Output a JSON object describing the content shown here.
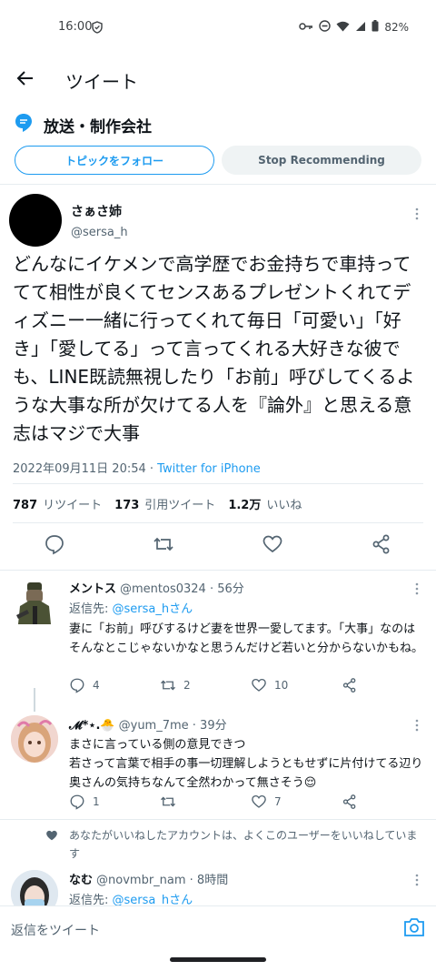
{
  "status": {
    "time": "16:00",
    "battery": "82%"
  },
  "header": {
    "title": "ツイート"
  },
  "topic": {
    "label": "放送・制作会社",
    "follow_btn": "トピックをフォロー",
    "stop_btn": "Stop Recommending"
  },
  "tweet": {
    "display_name": "さぁさ姉",
    "handle": "@sersa_h",
    "text": "どんなにイケメンで高学歴でお金持ちで車持っててて相性が良くてセンスあるプレゼントくれてディズニー一緒に行ってくれて毎日「可愛い」「好き」「愛してる」って言ってくれる大好きな彼でも、LINE既読無視したり「お前」呼びしてくるような大事な所が欠けてる人を『論外』と思える意志はマジで大事",
    "datetime": "2022年09月11日 20:54",
    "separator": " · ",
    "source": "Twitter for iPhone",
    "retweets_count": "787",
    "retweets_label": "リツイート",
    "quotes_count": "173",
    "quotes_label": "引用ツイート",
    "likes_count": "1.2万",
    "likes_label": "いいね"
  },
  "replies": [
    {
      "name": "メントス",
      "handle_time": "@mentos0324 · 56分",
      "reply_prefix": "返信先: ",
      "reply_to": "@sersa_hさん",
      "text": "妻に「お前」呼びするけど妻を世界一愛してます。「大事」なのはそんなとこじゃないかなと思うんだけど若いと分からないかもね。",
      "replies": "4",
      "retweets": "2",
      "likes": "10"
    },
    {
      "name": "𝓜*⋆.🐣",
      "handle_time": "@yum_7me · 39分",
      "text": "まさに言っている側の意見できつ\n若さって言葉で相手の事一切理解しようともせずに片付けてる辺り奥さんの気持ちなんて全然わかって無さそう😌",
      "replies": "1",
      "retweets": "",
      "likes": "7"
    },
    {
      "name": "なむ",
      "handle_time": "@novmbr_nam · 8時間",
      "reply_prefix": "返信先: ",
      "reply_to": "@sersa_hさん"
    }
  ],
  "liked_note": "あなたがいいねしたアカウントは、よくこのユーザーをいいねしています",
  "compose": {
    "placeholder": "返信をツイート"
  }
}
